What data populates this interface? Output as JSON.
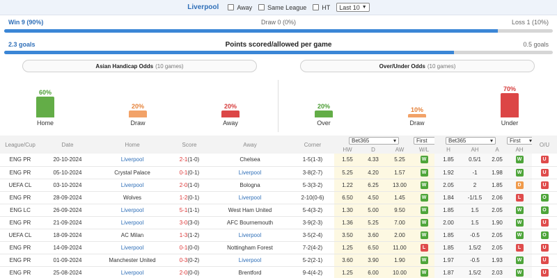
{
  "topbar": {
    "team": "Liverpool",
    "away_label": "Away",
    "same_league_label": "Same League",
    "ht_label": "HT",
    "last_select": "Last 10"
  },
  "summary": {
    "win_text": "Win 9 (90%)",
    "draw_text": "Draw 0 (0%)",
    "loss_text": "Loss 1 (10%)",
    "win_fraction": 0.9,
    "goals_for": "2.3 goals",
    "points_title": "Points scored/allowed per game",
    "goals_against": "0.5 goals",
    "goals_fraction": 0.82
  },
  "asian_handicap": {
    "title": "Asian Handicap Odds",
    "subtitle": "(10 games)",
    "home": {
      "pct": "60%",
      "label": "Home",
      "value": 60
    },
    "draw": {
      "pct": "20%",
      "label": "Draw",
      "value": 20
    },
    "away": {
      "pct": "20%",
      "label": "Away",
      "value": 20
    }
  },
  "over_under": {
    "title": "Over/Under Odds",
    "subtitle": "(10 games)",
    "over": {
      "pct": "20%",
      "label": "Over",
      "value": 20
    },
    "draw": {
      "pct": "10%",
      "label": "Draw",
      "value": 10
    },
    "under": {
      "pct": "70%",
      "label": "Under",
      "value": 70
    }
  },
  "table": {
    "headers": {
      "league": "League/Cup",
      "date": "Date",
      "home": "Home",
      "score": "Score",
      "away": "Away",
      "corner": "Corner",
      "bookmaker1": "Bet365",
      "period1": "First",
      "bookmaker2": "Bet365",
      "period2": "First",
      "ou": "O/U",
      "hw": "HW",
      "d": "D",
      "aw": "AW",
      "wl": "W/L",
      "h": "H",
      "ah": "AH",
      "a": "A",
      "ah2": "AH"
    },
    "rows": [
      {
        "league": "ENG PR",
        "date": "20-10-2024",
        "home": "Liverpool",
        "score": "2-1",
        "ht": "(1-0)",
        "away": "Chelsea",
        "corner": "1-5(1-3)",
        "hw": "1.55",
        "d": "4.33",
        "aw": "5.25",
        "wl": "W",
        "h": "1.85",
        "ah": "0.5/1",
        "a": "2.05",
        "ah2": "W",
        "ou": "U",
        "home_is_lpool": true
      },
      {
        "league": "ENG PR",
        "date": "05-10-2024",
        "home": "Crystal Palace",
        "score": "0-1",
        "ht": "(0-1)",
        "away": "Liverpool",
        "corner": "3-8(2-7)",
        "hw": "5.25",
        "d": "4.20",
        "aw": "1.57",
        "wl": "W",
        "h": "1.92",
        "ah": "-1",
        "a": "1.98",
        "ah2": "W",
        "ou": "U",
        "home_is_lpool": false
      },
      {
        "league": "UEFA CL",
        "date": "03-10-2024",
        "home": "Liverpool",
        "score": "2-0",
        "ht": "(1-0)",
        "away": "Bologna",
        "corner": "5-3(3-2)",
        "hw": "1.22",
        "d": "6.25",
        "aw": "13.00",
        "wl": "W",
        "h": "2.05",
        "ah": "2",
        "a": "1.85",
        "ah2": "D",
        "ou": "U",
        "home_is_lpool": true
      },
      {
        "league": "ENG PR",
        "date": "28-09-2024",
        "home": "Wolves",
        "score": "1-2",
        "ht": "(0-1)",
        "away": "Liverpool",
        "corner": "2-10(0-6)",
        "hw": "6.50",
        "d": "4.50",
        "aw": "1.45",
        "wl": "W",
        "h": "1.84",
        "ah": "-1/1.5",
        "a": "2.06",
        "ah2": "L",
        "ou": "O",
        "home_is_lpool": false
      },
      {
        "league": "ENG LC",
        "date": "26-09-2024",
        "home": "Liverpool",
        "score": "5-1",
        "ht": "(1-1)",
        "away": "West Ham United",
        "corner": "5-4(3-2)",
        "hw": "1.30",
        "d": "5.00",
        "aw": "9.50",
        "wl": "W",
        "h": "1.85",
        "ah": "1.5",
        "a": "2.05",
        "ah2": "W",
        "ou": "O",
        "home_is_lpool": true
      },
      {
        "league": "ENG PR",
        "date": "21-09-2024",
        "home": "Liverpool",
        "score": "3-0",
        "ht": "(3-0)",
        "away": "AFC Bournemouth",
        "corner": "3-9(2-3)",
        "hw": "1.36",
        "d": "5.25",
        "aw": "7.00",
        "wl": "W",
        "h": "2.00",
        "ah": "1.5",
        "a": "1.90",
        "ah2": "W",
        "ou": "U",
        "home_is_lpool": true
      },
      {
        "league": "UEFA CL",
        "date": "18-09-2024",
        "home": "AC Milan",
        "score": "1-3",
        "ht": "(1-2)",
        "away": "Liverpool",
        "corner": "3-5(2-4)",
        "hw": "3.50",
        "d": "3.60",
        "aw": "2.00",
        "wl": "W",
        "h": "1.85",
        "ah": "-0.5",
        "a": "2.05",
        "ah2": "W",
        "ou": "O",
        "home_is_lpool": false
      },
      {
        "league": "ENG PR",
        "date": "14-09-2024",
        "home": "Liverpool",
        "score": "0-1",
        "ht": "(0-0)",
        "away": "Nottingham Forest",
        "corner": "7-2(4-2)",
        "hw": "1.25",
        "d": "6.50",
        "aw": "11.00",
        "wl": "L",
        "h": "1.85",
        "ah": "1.5/2",
        "a": "2.05",
        "ah2": "L",
        "ou": "U",
        "home_is_lpool": true
      },
      {
        "league": "ENG PR",
        "date": "01-09-2024",
        "home": "Manchester United",
        "score": "0-3",
        "ht": "(0-2)",
        "away": "Liverpool",
        "corner": "5-2(2-1)",
        "hw": "3.60",
        "d": "3.90",
        "aw": "1.90",
        "wl": "W",
        "h": "1.97",
        "ah": "-0.5",
        "a": "1.93",
        "ah2": "W",
        "ou": "U",
        "home_is_lpool": false
      },
      {
        "league": "ENG PR",
        "date": "25-08-2024",
        "home": "Liverpool",
        "score": "2-0",
        "ht": "(0-0)",
        "away": "Brentford",
        "corner": "9-4(4-2)",
        "hw": "1.25",
        "d": "6.00",
        "aw": "10.00",
        "wl": "W",
        "h": "1.87",
        "ah": "1.5/2",
        "a": "2.03",
        "ah2": "W",
        "ou": "U",
        "home_is_lpool": true
      }
    ]
  }
}
